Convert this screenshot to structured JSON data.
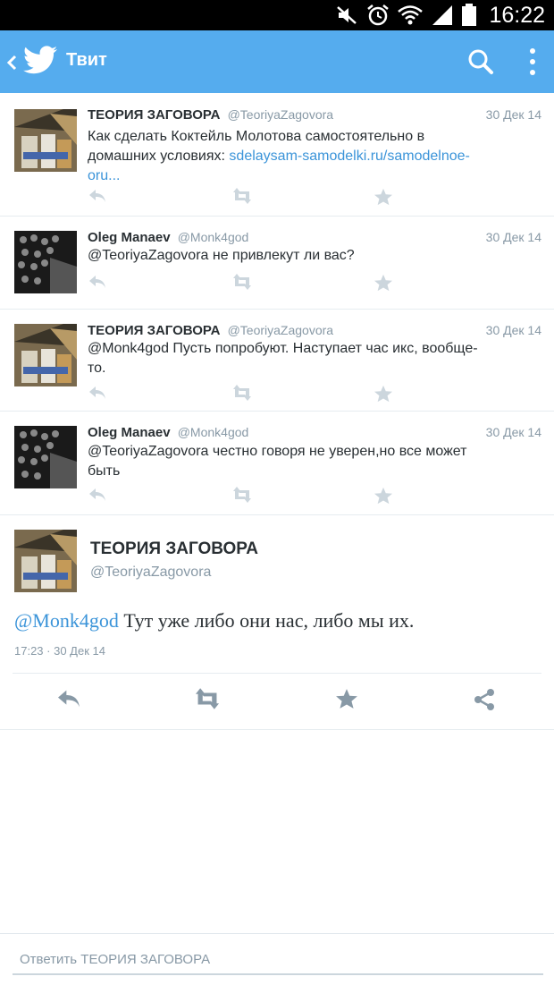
{
  "status_bar": {
    "time": "16:22",
    "icons": [
      "mute-icon",
      "alarm-icon",
      "wifi-icon",
      "signal-icon",
      "battery-icon"
    ]
  },
  "app_bar": {
    "title": "Твит",
    "background": "#55acee",
    "icons": [
      "back-icon",
      "twitter-bird-icon",
      "search-icon",
      "more-vert-icon"
    ]
  },
  "tweets": [
    {
      "name": "ТЕОРИЯ ЗАГОВОРА",
      "handle": "@TeoriyaZagovora",
      "date": "30 Дек 14",
      "text_line1": "Как сделать Коктейль Молотова самостоятельно в",
      "text_line2_prefix": "домашних условиях: ",
      "link_part1": "sdelaysam-samodelki.ru/samodelnoe-",
      "link_part2": "oru..."
    },
    {
      "name": "Oleg Manaev",
      "handle": "@Monk4god",
      "date": "30 Дек 14",
      "text_line1": "@TeoriyaZagovora не привлекут ли вас?"
    },
    {
      "name": "ТЕОРИЯ ЗАГОВОРА",
      "handle": "@TeoriyaZagovora",
      "date": "30 Дек 14",
      "text_line1": "@Monk4god Пусть попробуют. Наступает час икс, вообще-",
      "text_line2": "то."
    },
    {
      "name": "Oleg Manaev",
      "handle": "@Monk4god",
      "date": "30 Дек 14",
      "text_line1": "@TeoriyaZagovora честно говоря не уверен,но все может",
      "text_line2": "быть"
    }
  ],
  "detail": {
    "name": "ТЕОРИЯ ЗАГОВОРА",
    "handle": "@TeoriyaZagovora",
    "mention": "@Monk4god",
    "text": " Тут уже либо они нас, либо мы их.",
    "timestamp": "17:23 · 30 Дек 14",
    "actions": [
      "reply-icon",
      "retweet-icon",
      "favorite-icon",
      "share-icon"
    ]
  },
  "reply_bar": {
    "placeholder": "Ответить ТЕОРИЯ ЗАГОВОРА"
  },
  "colors": {
    "accent": "#55acee",
    "link": "#3b94d9",
    "muted": "#8899a6",
    "action_inactive": "#ccd6dd",
    "action_active": "#8899a6"
  }
}
